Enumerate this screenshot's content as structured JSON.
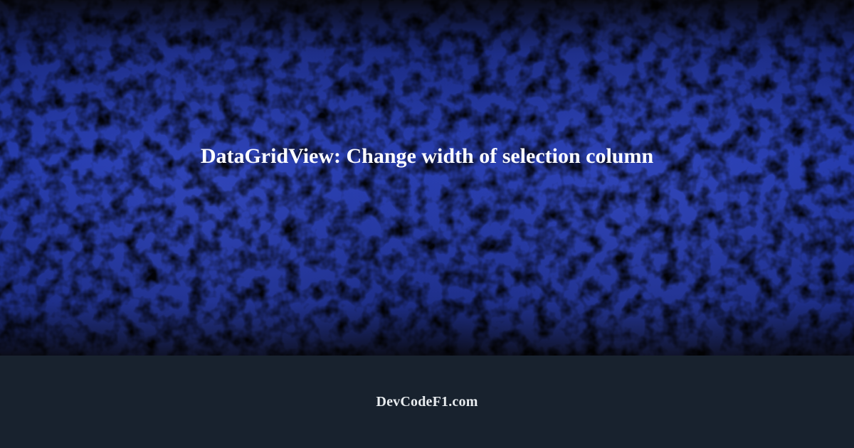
{
  "hero": {
    "title": "DataGridView: Change width of selection column"
  },
  "footer": {
    "brand": "DevCodeF1.com"
  }
}
